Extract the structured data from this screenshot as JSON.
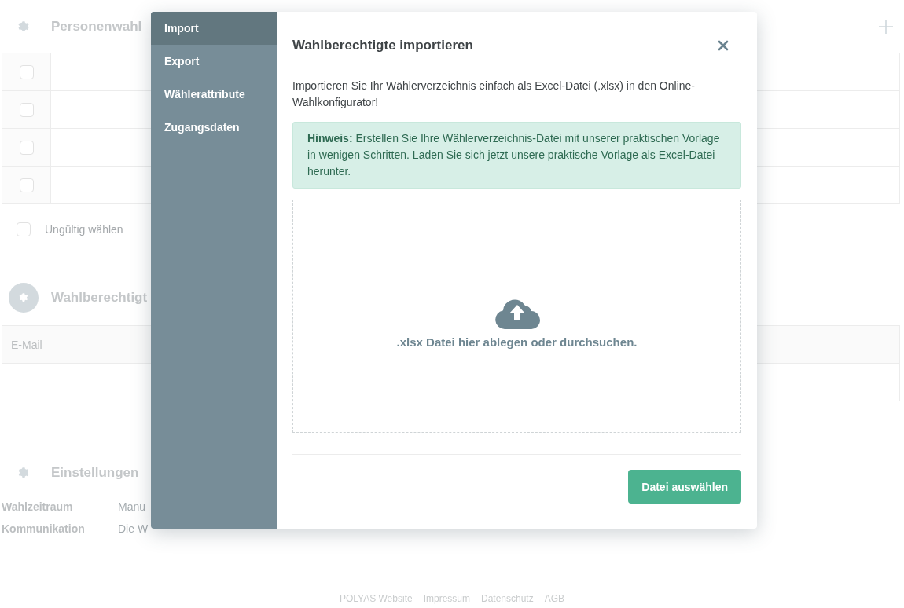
{
  "page": {
    "election": {
      "title": "Personenwahl",
      "rows": [
        {
          "checked": false
        },
        {
          "checked": false
        },
        {
          "checked": false
        },
        {
          "checked": false
        }
      ]
    },
    "invalid_option": {
      "label": "Ungültig wählen",
      "checked": false
    },
    "voters": {
      "title": "Wahlberechtigt",
      "columns": [
        "E-Mail"
      ]
    },
    "settings": {
      "title": "Einstellungen",
      "rows": [
        {
          "label": "Wahlzeitraum",
          "value": "Manu"
        },
        {
          "label": "Kommunikation",
          "value": "Die W"
        }
      ]
    },
    "footer": [
      "POLYAS Website",
      "Impressum",
      "Datenschutz",
      "AGB"
    ]
  },
  "dialog": {
    "menu": [
      {
        "label": "Import",
        "selected": true
      },
      {
        "label": "Export",
        "selected": false
      },
      {
        "label": "Wählerattribute",
        "selected": false
      },
      {
        "label": "Zugangsdaten",
        "selected": false
      }
    ],
    "title": "Wahlberechtigte importieren",
    "intro": "Importieren Sie Ihr Wählerverzeichnis einfach als Excel-Datei (.xlsx) in den Online-Wahlkonfigurator!",
    "hint": "**Hinweis:** Erstellen Sie Ihre Wählerverzeichnis-Datei mit unserer praktischen Vorlage in wenigen Schritten. Laden Sie sich jetzt unsere praktische Vorlage als Excel-Datei herunter.",
    "dropzone": {
      "text": ".xlsx Datei hier ablegen oder durchsuchen."
    },
    "button": "Datei auswählen"
  }
}
